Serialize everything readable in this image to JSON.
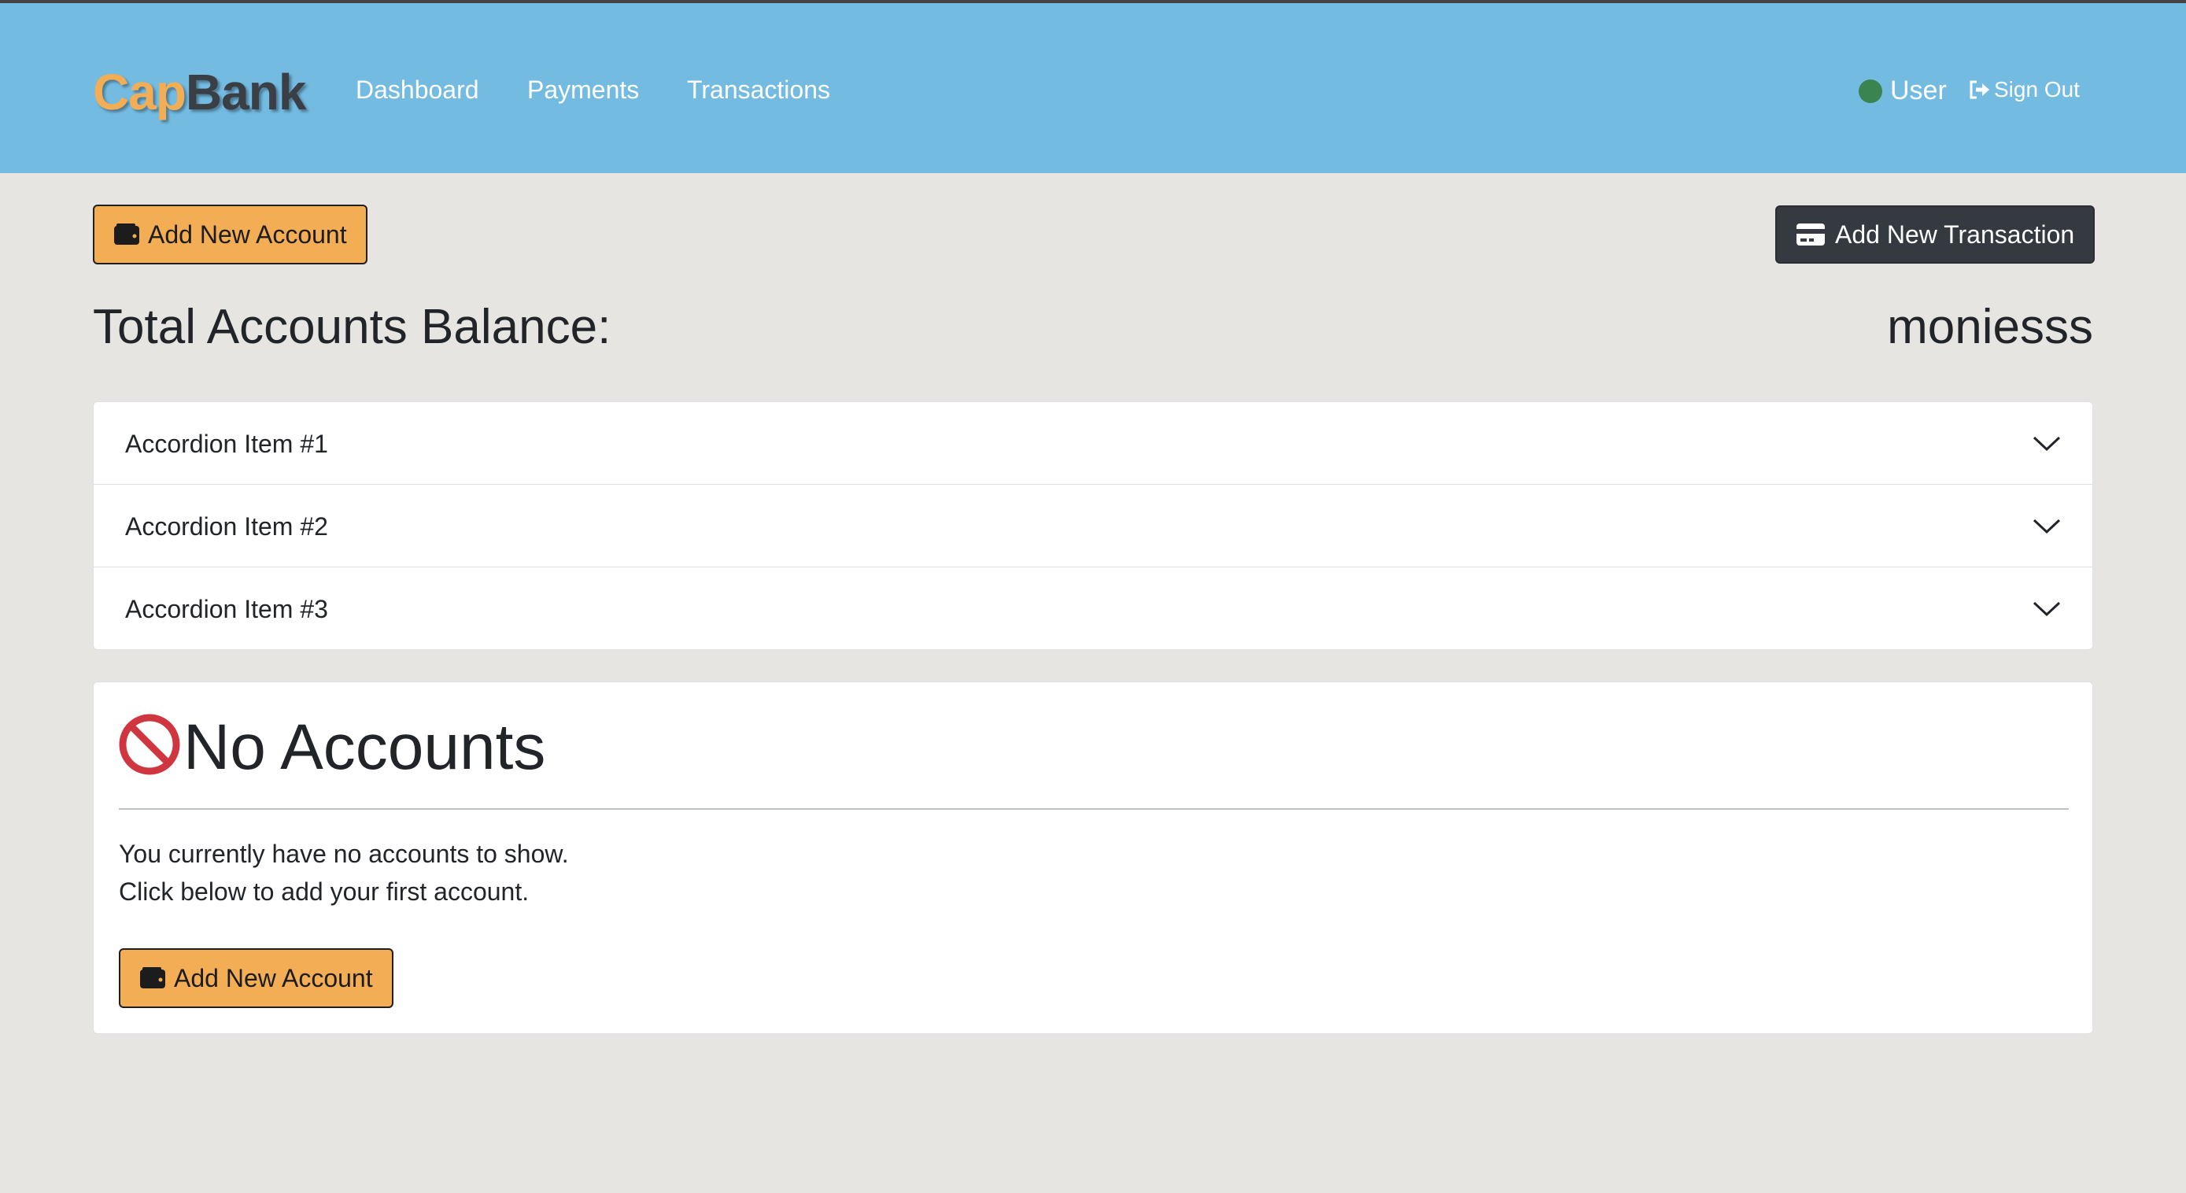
{
  "brand": {
    "part1": "Cap",
    "part2": "Bank"
  },
  "nav": {
    "links": [
      "Dashboard",
      "Payments",
      "Transactions"
    ],
    "user_label": "User",
    "signout_label": "Sign Out"
  },
  "actions": {
    "add_account_label": "Add New Account",
    "add_transaction_label": "Add New Transaction"
  },
  "balance": {
    "label": "Total Accounts Balance:",
    "value": "moniesss"
  },
  "accordion": {
    "items": [
      "Accordion Item #1",
      "Accordion Item #2",
      "Accordion Item #3"
    ]
  },
  "empty_state": {
    "icon": "prohibited-icon",
    "title": "No Accounts",
    "line1": "You currently have no accounts to show.",
    "line2": "Click below to add your first account.",
    "button_label": "Add New Account"
  },
  "colors": {
    "navbar": "#74bbe2",
    "accent_yellow": "#f2ad55",
    "dark_button": "#353a40",
    "status_online": "#3a8450",
    "prohibited_red": "#d0363f",
    "background": "#e6e5e1"
  }
}
